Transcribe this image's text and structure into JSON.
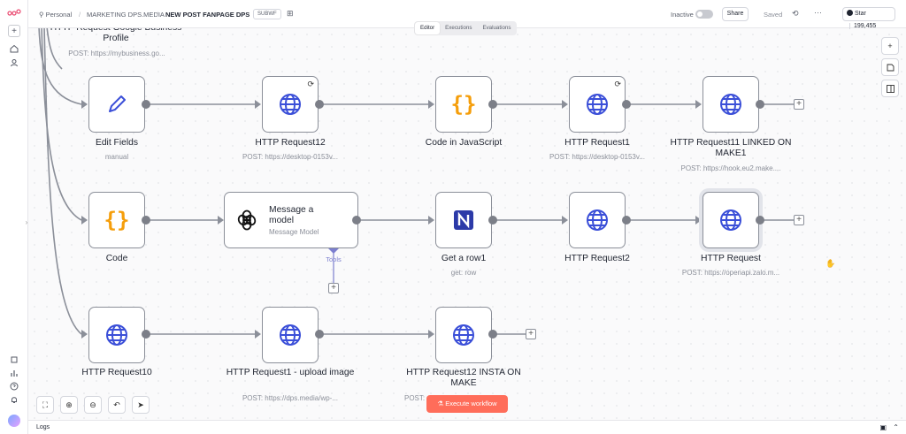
{
  "topbar": {
    "breadcrumb_owner": "Personal",
    "breadcrumb_folder": "MARKETING DPS.MEDIA",
    "workflow_name": "NEW POST FANPAGE DPS",
    "workflow_tag": "SUBWF",
    "status_label": "Inactive",
    "share_label": "Share",
    "saved_label": "Saved",
    "star_label": "Star",
    "star_count": "199,455"
  },
  "tabs": [
    {
      "label": "Editor",
      "active": true
    },
    {
      "label": "Executions",
      "active": false
    },
    {
      "label": "Evaluations",
      "active": false
    }
  ],
  "nodes": {
    "top_partial": {
      "title": "HTTP Request Google Business Profile",
      "sub": "POST: https://mybusiness.go..."
    },
    "edit_fields": {
      "title": "Edit Fields",
      "sub": "manual"
    },
    "http12": {
      "title": "HTTP Request12",
      "sub": "POST: https://desktop-0153v..."
    },
    "code_js": {
      "title": "Code in JavaScript",
      "sub": ""
    },
    "http1": {
      "title": "HTTP Request1",
      "sub": "POST: https://desktop-0153v..."
    },
    "http11": {
      "title": "HTTP Request11 LINKED ON MAKE1",
      "sub": "POST: https://hook.eu2.make...."
    },
    "code": {
      "title": "Code",
      "sub": ""
    },
    "message_model": {
      "title": "Message a model",
      "sub": "Message Model",
      "port": "Tools"
    },
    "get_row": {
      "title": "Get a row1",
      "sub": "get: row"
    },
    "http2": {
      "title": "HTTP Request2",
      "sub": ""
    },
    "http_zalo": {
      "title": "HTTP Request",
      "sub": "POST: https://openapi.zalo.m..."
    },
    "http10": {
      "title": "HTTP Request10",
      "sub": ""
    },
    "http1_upload": {
      "title": "HTTP Request1 - upload image",
      "sub": "POST: https://dps.media/wp-..."
    },
    "http12_insta": {
      "title": "HTTP Request12 INSTA ON MAKE",
      "sub": "POST: ..."
    }
  },
  "execute_label": "Execute workflow",
  "logs_label": "Logs",
  "colors": {
    "accent": "#ff6d5a",
    "globe": "#3b4fd8",
    "code": "#f59e0b",
    "ai_port": "#7c7fcf"
  }
}
